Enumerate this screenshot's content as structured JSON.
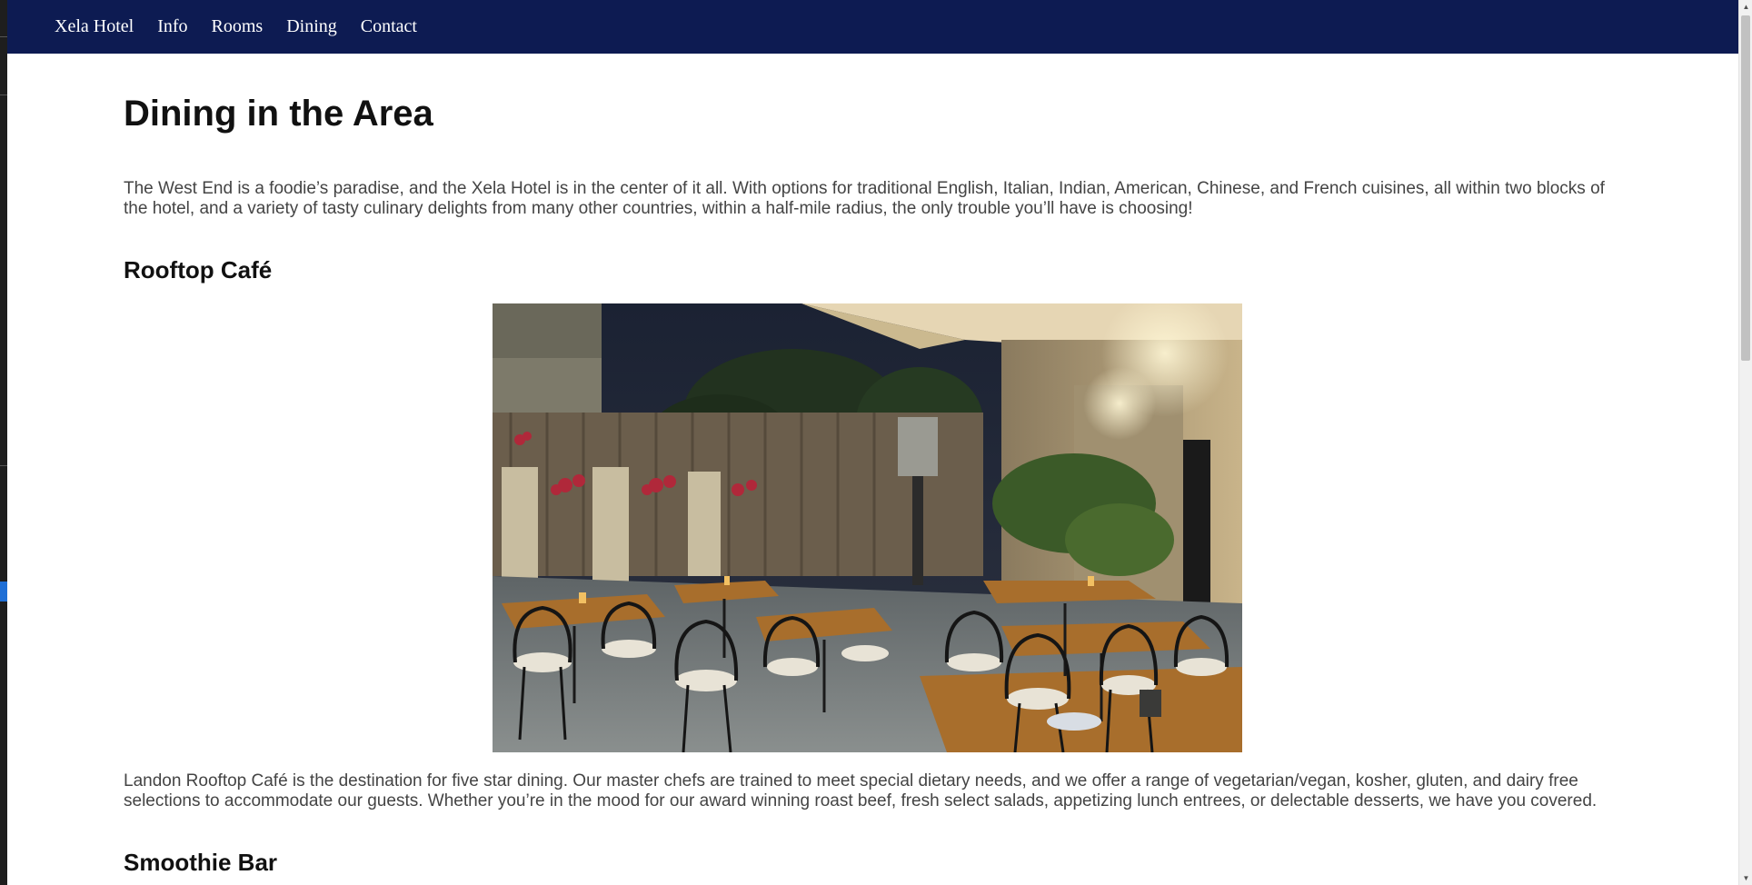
{
  "nav": {
    "brand": "Xela Hotel",
    "items": [
      {
        "label": "Info"
      },
      {
        "label": "Rooms"
      },
      {
        "label": "Dining"
      },
      {
        "label": "Contact"
      }
    ]
  },
  "main": {
    "title": "Dining in the Area",
    "intro": "The West End is a foodie’s paradise, and the Xela Hotel is in the center of it all. With options for traditional English, Italian, Indian, American, Chinese, and French cuisines, all within two blocks of the hotel, and a variety of tasty culinary delights from many other countries, within a half-mile radius, the only trouble you’ll have is choosing!",
    "sections": [
      {
        "heading": "Rooftop Café",
        "image": "rooftop-cafe-photo",
        "description": "Landon Rooftop Café is the destination for five star dining. Our master chefs are trained to meet special dietary needs, and we offer a range of vegetarian/vegan, kosher, gluten, and dairy free selections to accommodate our guests. Whether you’re in the mood for our award winning roast beef, fresh select salads, appetizing lunch entrees, or delectable desserts, we have you covered."
      },
      {
        "heading": "Smoothie Bar"
      }
    ]
  },
  "colors": {
    "navbar": "#0d1b52",
    "heading": "#111111",
    "body_text": "#444444"
  },
  "scrollbar": {
    "up_arrow": "▲",
    "down_arrow": "▼"
  }
}
